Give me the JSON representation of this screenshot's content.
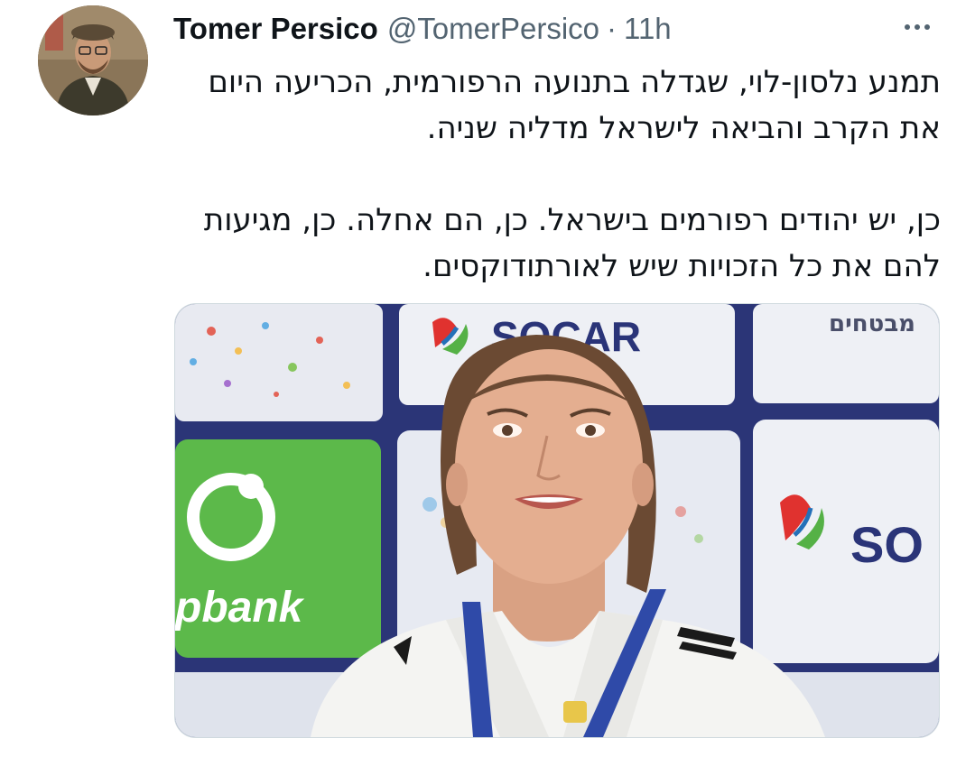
{
  "tweet": {
    "author_name": "Tomer Persico",
    "author_handle": "@TomerPersico",
    "separator": "·",
    "time": "11h",
    "text_lines": [
      "תמנע נלסון-לוי, שגדלה בתנועה הרפורמית, הכריעה היום",
      "את הקרב והביאה לישראל מדליה שניה.",
      "",
      "כן, יש יהודים רפורמים בישראל. כן, הם אחלה. כן, מגיעות",
      "להם את כל הזכויות שיש לאורתודוקסים."
    ]
  },
  "icons": {
    "more": "more-horizontal-icon"
  },
  "media": {
    "sponsor_text_top": "SOCAR",
    "sponsor_text_right": "SO",
    "sponsor_text_left": "pbank",
    "sponsor_text_hebrew": "מבטחים"
  },
  "colors": {
    "text_primary": "#0f1419",
    "text_secondary": "#536471",
    "border": "#cfd9de",
    "green_board": "#5cb94a",
    "navy_board": "#23306e"
  }
}
